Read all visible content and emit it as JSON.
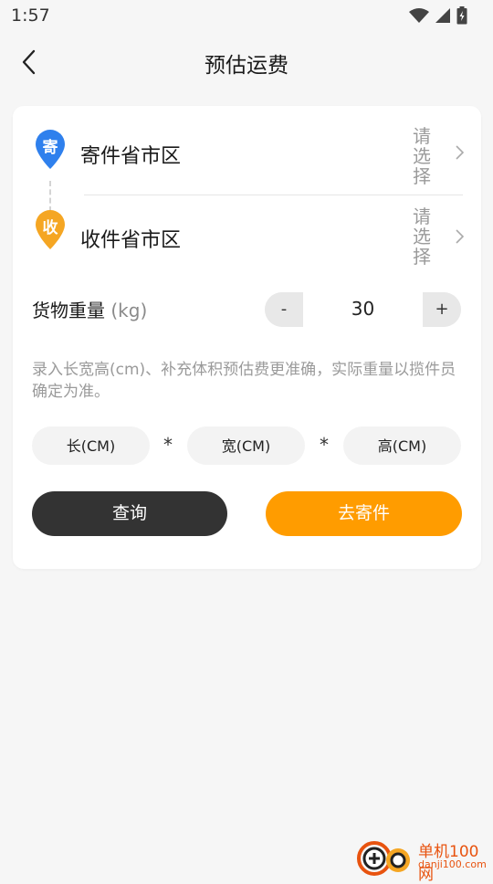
{
  "status_bar": {
    "time": "1:57"
  },
  "nav": {
    "title": "预估运费"
  },
  "sender": {
    "badge": "寄",
    "label": "寄件省市区",
    "hint": "请选择"
  },
  "receiver": {
    "badge": "收",
    "label": "收件省市区",
    "hint": "请选择"
  },
  "weight": {
    "label": "货物重量",
    "unit": "(kg)",
    "minus": "-",
    "plus": "+",
    "value": "30"
  },
  "hint": "录入长宽高(cm)、补充体积预估费更准确，实际重量以揽件员确定为准。",
  "dimensions": {
    "length_placeholder": "长(CM)",
    "width_placeholder": "宽(CM)",
    "height_placeholder": "高(CM)",
    "separator": "*"
  },
  "actions": {
    "query": "查询",
    "send": "去寄件"
  },
  "watermark": {
    "title": "单机100网",
    "url": "danji100.com"
  },
  "colors": {
    "sender_pin": "#2f80ed",
    "receiver_pin": "#f5a623",
    "accent": "#ff9c00",
    "dark_button": "#333333"
  }
}
